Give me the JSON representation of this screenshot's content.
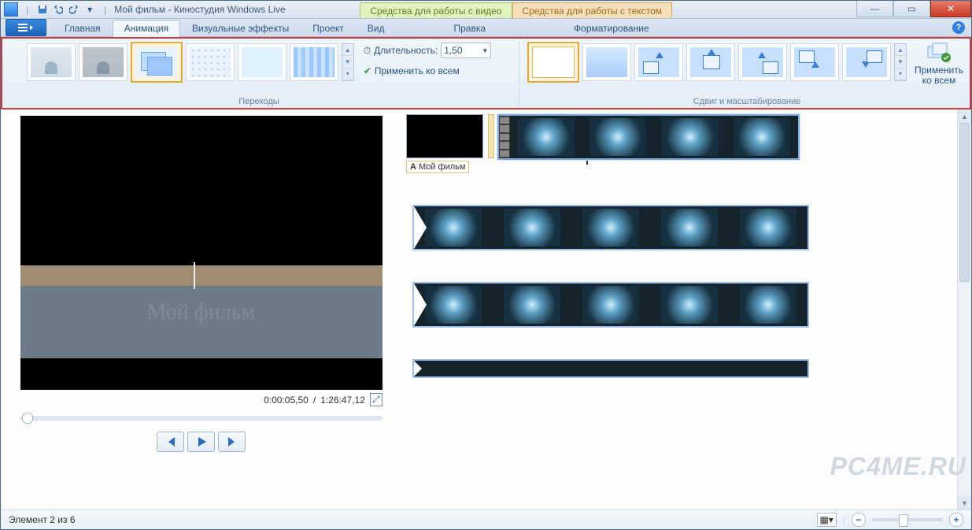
{
  "titlebar": {
    "title": "Мой фильм - Киностудия Windows Live",
    "context_tabs": {
      "video": "Средства для работы с видео",
      "text": "Средства для работы с текстом"
    }
  },
  "ribbon_tabs": {
    "home": "Главная",
    "animation": "Анимация",
    "effects": "Визуальные эффекты",
    "project": "Проект",
    "view": "Вид",
    "edit": "Правка",
    "format": "Форматирование"
  },
  "ribbon": {
    "transitions_group": "Переходы",
    "panzoom_group": "Сдвиг и масштабирование",
    "duration_label": "Длительность:",
    "duration_value": "1,50",
    "apply_all": "Применить ко всем",
    "apply_all_big": "Применить\nко всем"
  },
  "preview": {
    "title_overlay": "Мой фильм",
    "time_current": "0:00:05,50",
    "time_total": "1:26:47,12"
  },
  "timeline": {
    "title_clip_label": "Мой фильм"
  },
  "statusbar": {
    "position": "Элемент 2 из 6"
  },
  "watermark": "PC4ME.RU"
}
